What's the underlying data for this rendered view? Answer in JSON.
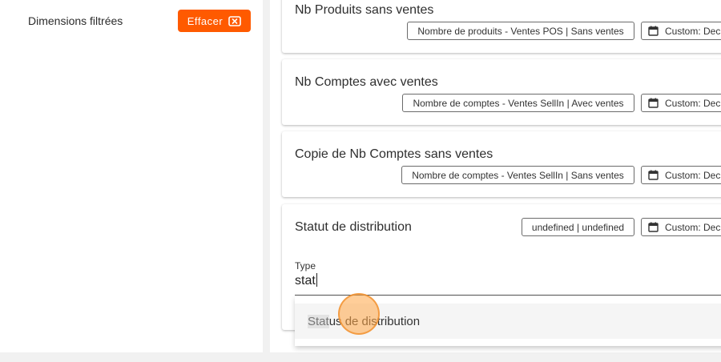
{
  "filters": {
    "label": "Dimensions filtrées",
    "clear_button": "Effacer"
  },
  "cards": [
    {
      "title": "Nb Produits sans ventes",
      "tag": "Nombre de produits - Ventes POS | Sans ventes",
      "date": "Custom: Dec"
    },
    {
      "title": "Nb Comptes avec ventes",
      "tag": "Nombre de comptes - Ventes SellIn | Avec ventes",
      "date": "Custom: Dec"
    },
    {
      "title": "Copie de Nb Comptes sans ventes",
      "tag": "Nombre de comptes - Ventes SellIn | Sans ventes",
      "date": "Custom: Dec"
    },
    {
      "title": "Statut de distribution",
      "tag": "undefined | undefined",
      "date": "Custom: Dec"
    }
  ],
  "type_field": {
    "label": "Type",
    "value": "stat"
  },
  "suggestion": {
    "match": "Stat",
    "rest": "us de distribution"
  },
  "icons": {
    "clear": "close-box-icon",
    "calendar": "calendar-icon"
  },
  "colors": {
    "accent": "#ff5a00"
  }
}
